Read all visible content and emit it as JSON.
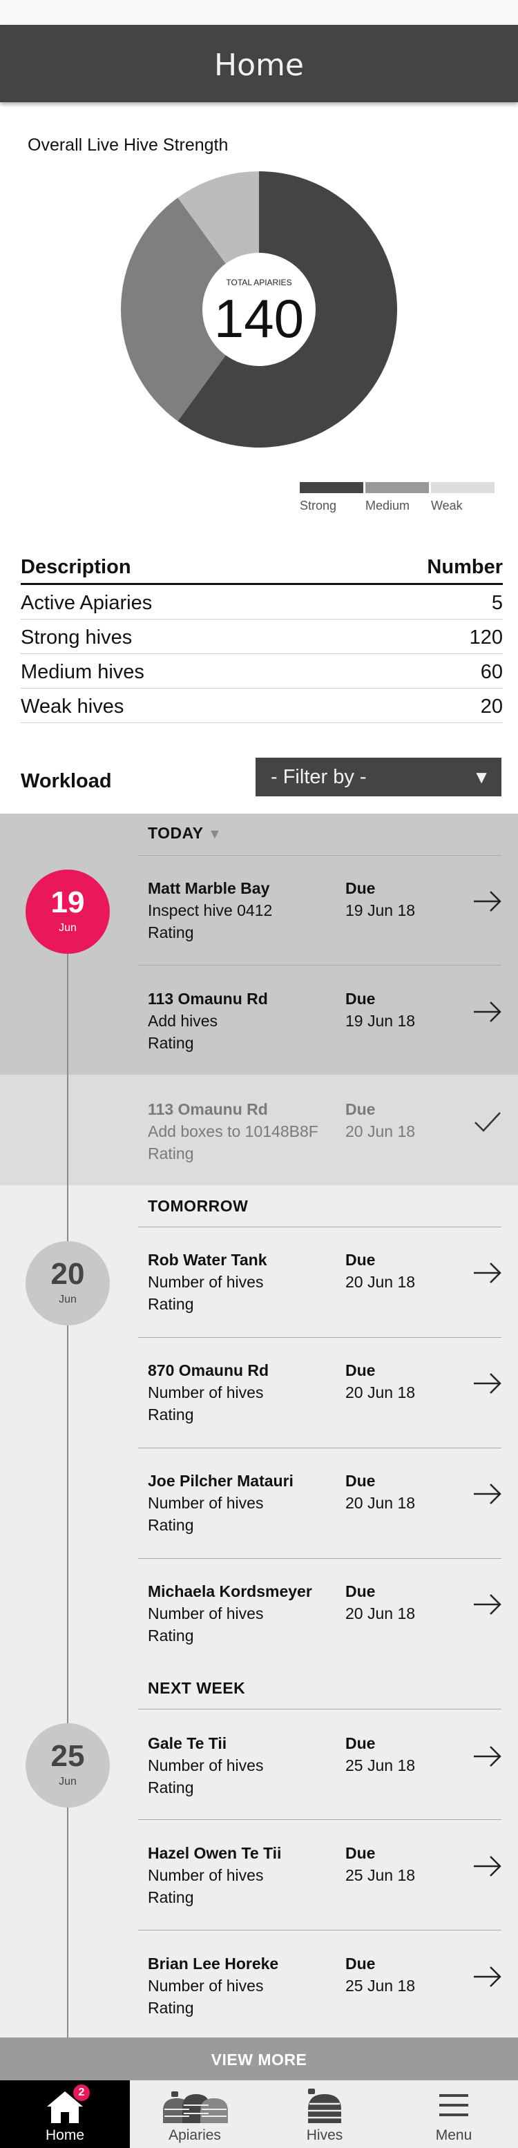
{
  "header": {
    "title": "Home"
  },
  "chart": {
    "title": "Overall Live Hive Strength",
    "center_label": "TOTAL APIARIES",
    "center_value": "140",
    "legend": [
      {
        "label": "Strong",
        "color": "#444444"
      },
      {
        "label": "Medium",
        "color": "#999999"
      },
      {
        "label": "Weak",
        "color": "#dddddd"
      }
    ]
  },
  "chart_data": {
    "type": "pie",
    "title": "Overall Live Hive Strength",
    "categories": [
      "Strong",
      "Medium",
      "Weak"
    ],
    "values": [
      120,
      60,
      20
    ],
    "colors": [
      "#444444",
      "#7f7f80",
      "#bcbcbd"
    ],
    "legend_placement": "bottom-right"
  },
  "table": {
    "headers": [
      "Description",
      "Number"
    ],
    "rows": [
      {
        "label": "Active Apiaries",
        "value": "5"
      },
      {
        "label": "Strong hives",
        "value": "120"
      },
      {
        "label": "Medium hives",
        "value": "60"
      },
      {
        "label": "Weak hives",
        "value": "20"
      }
    ]
  },
  "workload": {
    "title": "Workload",
    "filter": "- Filter by  -",
    "groups": [
      {
        "heading": "TODAY",
        "day": "19",
        "month": "Jun"
      },
      {
        "heading": "TOMORROW",
        "day": "20",
        "month": "Jun"
      },
      {
        "heading": "NEXT WEEK",
        "day": "25",
        "month": "Jun"
      }
    ],
    "tasks": [
      {
        "name": "Matt Marble Bay",
        "detail": "Inspect hive 0412",
        "rating": "Rating",
        "due_label": "Due",
        "due_date": "19 Jun 18"
      },
      {
        "name": "113 Omaunu Rd",
        "detail": "Add hives",
        "rating": "Rating",
        "due_label": "Due",
        "due_date": "19 Jun 18"
      },
      {
        "name": "113 Omaunu Rd",
        "detail": "Add boxes to 10148B8F",
        "rating": "Rating",
        "due_label": "Due",
        "due_date": "20 Jun 18"
      },
      {
        "name": "Rob Water Tank",
        "detail": "Number of hives",
        "rating": "Rating",
        "due_label": "Due",
        "due_date": "20 Jun 18"
      },
      {
        "name": "870 Omaunu Rd",
        "detail": "Number of hives",
        "rating": "Rating",
        "due_label": "Due",
        "due_date": "20 Jun 18"
      },
      {
        "name": "Joe Pilcher Matauri",
        "detail": "Number of hives",
        "rating": "Rating",
        "due_label": "Due",
        "due_date": "20 Jun 18"
      },
      {
        "name": "Michaela Kordsmeyer",
        "detail": "Number of hives",
        "rating": "Rating",
        "due_label": "Due",
        "due_date": "20 Jun 18"
      },
      {
        "name": "Gale Te Tii",
        "detail": "Number of hives",
        "rating": "Rating",
        "due_label": "Due",
        "due_date": "25 Jun 18"
      },
      {
        "name": "Hazel Owen Te Tii",
        "detail": "Number of hives",
        "rating": "Rating",
        "due_label": "Due",
        "due_date": "25 Jun 18"
      },
      {
        "name": "Brian Lee Horeke",
        "detail": "Number of hives",
        "rating": "Rating",
        "due_label": "Due",
        "due_date": "25 Jun 18"
      }
    ],
    "view_more": "VIEW MORE"
  },
  "tabbar": {
    "home": "Home",
    "home_badge": "2",
    "apiaries": "Apiaries",
    "hives": "Hives",
    "menu": "Menu"
  },
  "colors": {
    "header_bg": "#444444",
    "today_band": "#c8c8c8",
    "completed_band": "#dcdcdc",
    "workload_bg": "#eeeeee",
    "today_circle": "#e8185a",
    "date_circle": "#c8c8c8",
    "view_more_bg": "#9b9b9b"
  }
}
